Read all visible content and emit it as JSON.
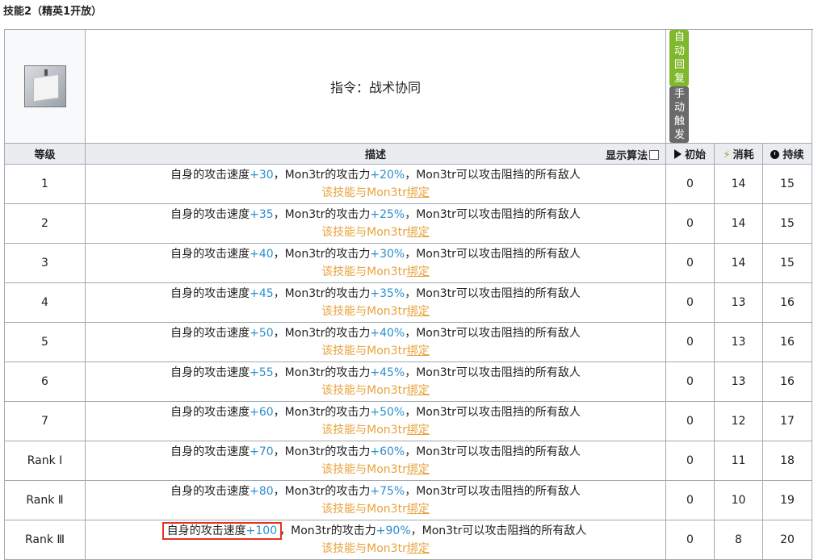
{
  "heading": "技能2（精英1开放）",
  "skill": {
    "name": "指令：战术协同",
    "badges": {
      "recovery": "自动回复",
      "trigger": "手动触发"
    }
  },
  "header": {
    "level": "等级",
    "description": "描述",
    "show_formula": "显示算法",
    "initial": "初始",
    "cost": "消耗",
    "duration": "持续"
  },
  "desc_text": {
    "atk_speed": "自身的攻击速度",
    "sep": "，",
    "mon_atk": "Mon3tr的攻击力",
    "tail": "Mon3tr可以攻击阻挡的所有敌人",
    "bind_pre": "该技能与Mon3tr",
    "bind_word": "绑定"
  },
  "rows": [
    {
      "level": "1",
      "speed": "+30",
      "atk": "+20%",
      "initial": "0",
      "cost": "14",
      "duration": "15"
    },
    {
      "level": "2",
      "speed": "+35",
      "atk": "+25%",
      "initial": "0",
      "cost": "14",
      "duration": "15"
    },
    {
      "level": "3",
      "speed": "+40",
      "atk": "+30%",
      "initial": "0",
      "cost": "14",
      "duration": "15"
    },
    {
      "level": "4",
      "speed": "+45",
      "atk": "+35%",
      "initial": "0",
      "cost": "13",
      "duration": "16"
    },
    {
      "level": "5",
      "speed": "+50",
      "atk": "+40%",
      "initial": "0",
      "cost": "13",
      "duration": "16"
    },
    {
      "level": "6",
      "speed": "+55",
      "atk": "+45%",
      "initial": "0",
      "cost": "13",
      "duration": "16"
    },
    {
      "level": "7",
      "speed": "+60",
      "atk": "+50%",
      "initial": "0",
      "cost": "12",
      "duration": "17"
    },
    {
      "level": "Rank Ⅰ",
      "speed": "+70",
      "atk": "+60%",
      "initial": "0",
      "cost": "11",
      "duration": "18"
    },
    {
      "level": "Rank Ⅱ",
      "speed": "+80",
      "atk": "+75%",
      "initial": "0",
      "cost": "10",
      "duration": "19"
    },
    {
      "level": "Rank Ⅲ",
      "speed": "+100",
      "atk": "+90%",
      "initial": "0",
      "cost": "8",
      "duration": "20"
    }
  ],
  "colors": {
    "value_blue": "#2e8fcc",
    "bind_orange": "#e8a33c",
    "highlight_red": "#e8311f",
    "auto_green": "#80b82d"
  }
}
